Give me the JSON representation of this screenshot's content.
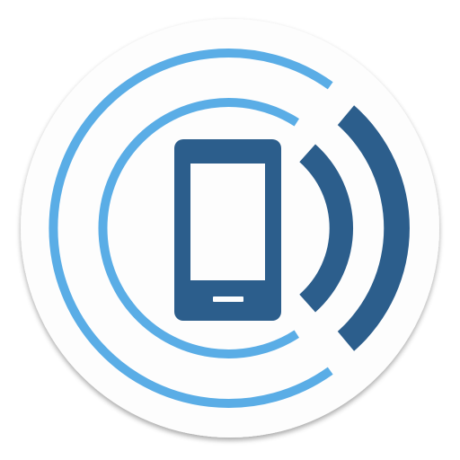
{
  "icon": {
    "name": "phone-signal-app-icon",
    "colors": {
      "background_disc": "#fdfdfd",
      "disc_shadow": "#d6d6d6",
      "outer_rings": "#5aade6",
      "signal_waves": "#2c5e8c",
      "phone_body": "#2c5e8c",
      "phone_screen": "#fdfdfd",
      "home_button": "#fdfdfd"
    },
    "parts": [
      "app-icon-disc",
      "outer-ring-icon",
      "inner-ring-icon",
      "signal-wave-inner-icon",
      "signal-wave-outer-icon",
      "smartphone-icon"
    ]
  }
}
